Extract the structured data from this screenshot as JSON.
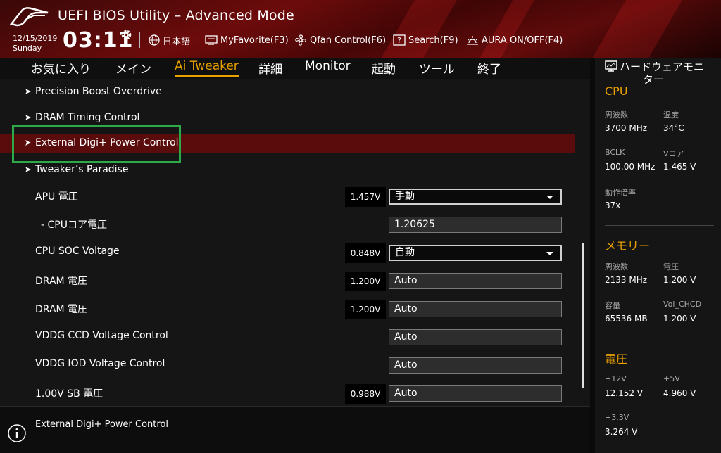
{
  "header": {
    "title": "UEFI BIOS Utility – Advanced Mode",
    "date": "12/15/2019",
    "day": "Sunday",
    "time": "03:11",
    "items": [
      {
        "label": "日本語",
        "icon": "globe-icon"
      },
      {
        "label": "MyFavorite(F3)",
        "icon": "monitor-icon"
      },
      {
        "label": "Qfan Control(F6)",
        "icon": "fan-icon"
      },
      {
        "label": "Search(F9)",
        "icon": "search-help-icon"
      },
      {
        "label": "AURA ON/OFF(F4)",
        "icon": "aura-icon"
      }
    ]
  },
  "tabs": [
    {
      "label": "お気に入り"
    },
    {
      "label": "メイン"
    },
    {
      "label": "Ai Tweaker",
      "active": true
    },
    {
      "label": "詳細"
    },
    {
      "label": "Monitor"
    },
    {
      "label": "起動"
    },
    {
      "label": "ツール"
    },
    {
      "label": "終了"
    }
  ],
  "menu": {
    "submenus": [
      "Precision Boost Overdrive",
      "DRAM Timing Control",
      "External Digi+ Power Control",
      "Tweaker’s Paradise"
    ],
    "settings": [
      {
        "label": "APU 電圧",
        "current": "1.457V",
        "value": "手動",
        "type": "dropdown"
      },
      {
        "label": "- CPUコア電圧",
        "current": "",
        "value": "1.20625",
        "type": "field"
      },
      {
        "label": "CPU SOC Voltage",
        "current": "0.848V",
        "value": "自動",
        "type": "dropdown"
      },
      {
        "label": "DRAM 電圧",
        "current": "1.200V",
        "value": "Auto",
        "type": "field"
      },
      {
        "label": "DRAM 電圧",
        "current": "1.200V",
        "value": "Auto",
        "type": "field"
      },
      {
        "label": "VDDG CCD Voltage Control",
        "current": "",
        "value": "Auto",
        "type": "field"
      },
      {
        "label": "VDDG IOD Voltage Control",
        "current": "",
        "value": "Auto",
        "type": "field"
      },
      {
        "label": "1.00V SB 電圧",
        "current": "0.988V",
        "value": "Auto",
        "type": "field"
      }
    ]
  },
  "description": "External Digi+ Power Control",
  "hw_monitor": {
    "title_line1": "ハードウェアモニ",
    "title_line2": "ター",
    "cpu": {
      "heading": "CPU",
      "freq_label": "周波数",
      "freq": "3700 MHz",
      "temp_label": "温度",
      "temp": "34°C",
      "bclk_label": "BCLK",
      "bclk": "100.00 MHz",
      "vcore_label": "Vコア",
      "vcore": "1.465 V",
      "ratio_label": "動作倍率",
      "ratio": "37x"
    },
    "memory": {
      "heading": "メモリー",
      "freq_label": "周波数",
      "freq": "2133 MHz",
      "volt_label": "電圧",
      "volt": "1.200 V",
      "cap_label": "容量",
      "cap": "65536 MB",
      "chcd_label": "Vol_CHCD",
      "chcd": "1.200 V"
    },
    "voltage": {
      "heading": "電圧",
      "v12_label": "+12V",
      "v12": "12.152 V",
      "v5_label": "+5V",
      "v5": "4.960 V",
      "v33_label": "+3.3V",
      "v33": "3.264 V"
    }
  },
  "colors": {
    "accent": "#e8a000",
    "highlight_row": "#5a0c0c",
    "focus_frame": "#2ea94a"
  }
}
